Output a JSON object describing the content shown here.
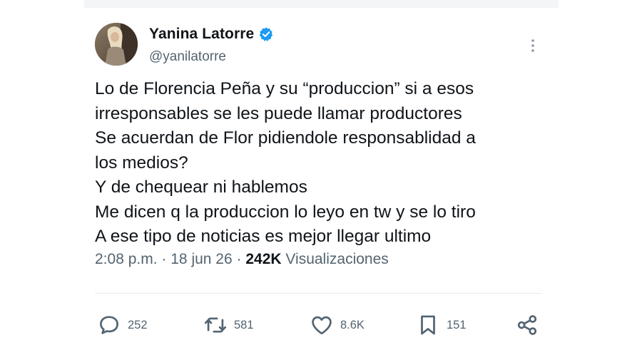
{
  "user": {
    "display_name": "Yanina Latorre",
    "handle": "@yanilatorre",
    "verified": true,
    "verified_color": "#1d9bf0"
  },
  "tweet": {
    "lines": [
      "Lo de Florencia Peña y su “produccion” si a esos",
      "irresponsables se les puede llamar productores",
      "Se acuerdan de Flor pidiendole responsablidad a",
      "los medios?",
      "Y de chequear ni hablemos",
      "Me dicen q la produccion lo leyo en tw y se lo tiro",
      "A ese tipo de noticias es mejor llegar ultimo"
    ]
  },
  "meta": {
    "time": "2:08 p.m.",
    "separator": "·",
    "date": "18 jun 26",
    "views_count": "242K",
    "views_label": "Visualizaciones"
  },
  "actions": {
    "replies": "252",
    "reposts": "581",
    "likes": "8.6K",
    "bookmarks": "151"
  },
  "icons": {
    "reply": "reply-icon",
    "repost": "repost-icon",
    "like": "heart-icon",
    "bookmark": "bookmark-icon",
    "share": "share-icon",
    "more": "more-options-icon",
    "verified": "verified-badge-icon"
  },
  "colors": {
    "text": "#0f1419",
    "secondary": "#536471",
    "icon": "#536471",
    "divider": "#e8ebed"
  }
}
